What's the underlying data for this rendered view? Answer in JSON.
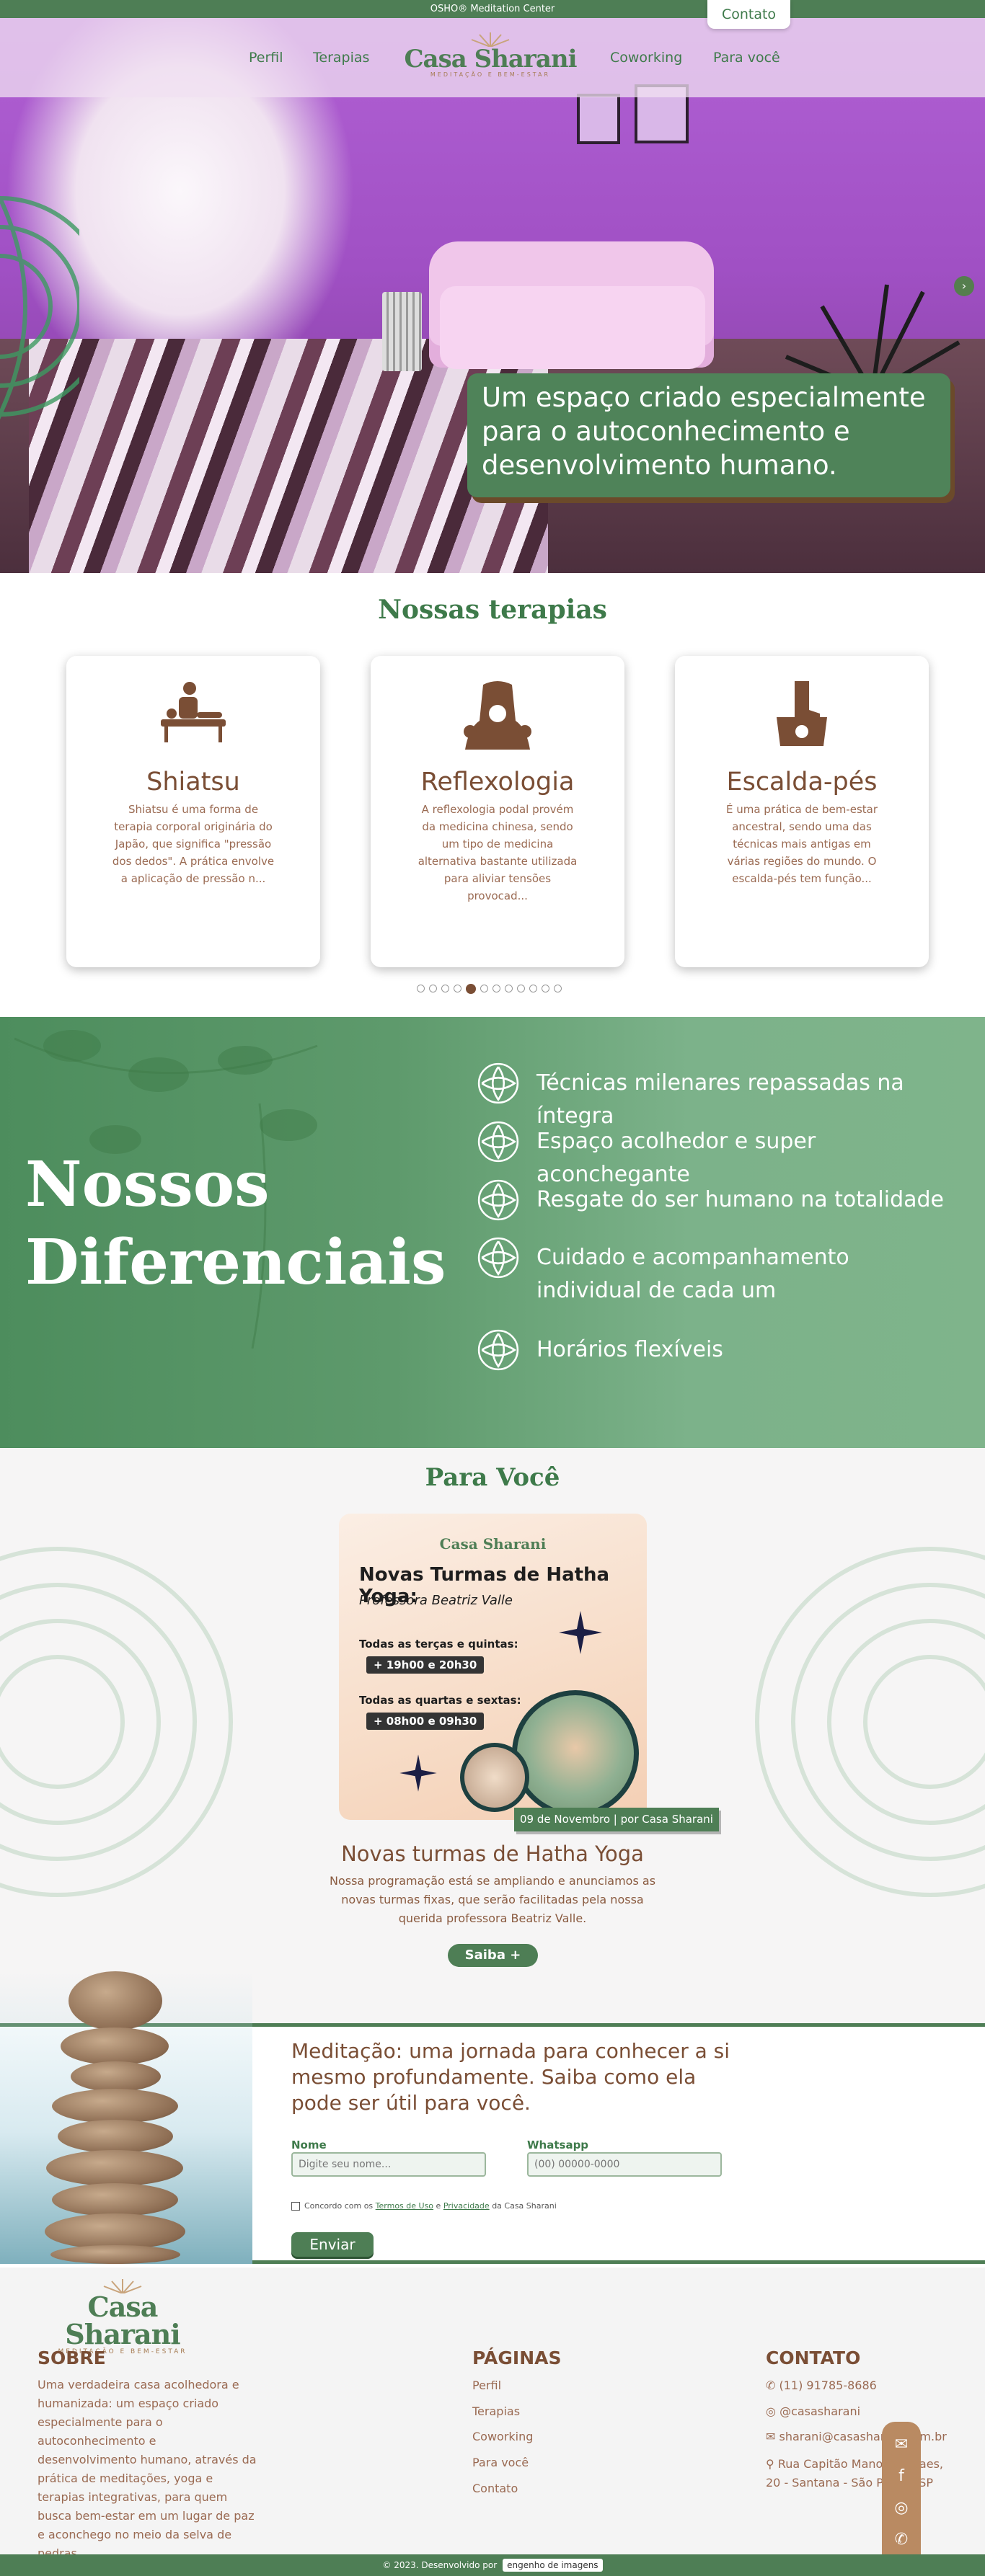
{
  "topbar": {
    "text": "OSHO® Meditation Center",
    "contact_label": "Contato"
  },
  "nav": {
    "items": [
      "Perfil",
      "Terapias",
      "Coworking",
      "Para você"
    ],
    "logo_name": "Casa Sharani",
    "logo_tagline": "MEDITAÇÃO E BEM-ESTAR"
  },
  "hero": {
    "caption": "Um espaço criado especialmente para o autoconhecimento e desenvolvimento humano."
  },
  "therapies": {
    "title": "Nossas terapias",
    "cards": [
      {
        "name": "Shiatsu",
        "text": "Shiatsu é uma forma de terapia corporal originária do Japão, que significa \"pressão dos dedos\". A prática envolve a aplicação de pressão n...",
        "icon": "massage-icon"
      },
      {
        "name": "Reflexologia",
        "text": "A reflexologia podal provém da medicina chinesa, sendo um tipo de medicina alternativa bastante utilizada para aliviar tensões provocad...",
        "icon": "foot-icon"
      },
      {
        "name": "Escalda-pés",
        "text": "É uma prática de bem-estar ancestral, sendo uma das técnicas mais antigas em várias regiões do mundo. O escalda-pés tem função...",
        "icon": "foot-bath-icon"
      }
    ],
    "dot_count": 12,
    "active_dot": 4
  },
  "differentials": {
    "title_line1": "Nossos",
    "title_line2": "Diferenciais",
    "items": [
      "Técnicas milenares repassadas na íntegra",
      "Espaço acolhedor e super aconchegante",
      "Resgate do ser humano na totalidade",
      "Cuidado e acompanhamento individual de cada um",
      "Horários flexíveis"
    ]
  },
  "para_voce": {
    "title": "Para Você",
    "post": {
      "logo": "Casa Sharani",
      "title": "Novas Turmas de Hatha Yoga:",
      "teacher": "Professora Beatriz Valle",
      "slot1_label": "Todas as terças e quintas:",
      "slot1_time": "19h00 e 20h30",
      "slot2_label": "Todas as quartas e sextas:",
      "slot2_time": "08h00 e 09h30"
    },
    "date": "09 de Novembro | por Casa Sharani",
    "heading": "Novas turmas de Hatha Yoga",
    "text": "Nossa programação está se ampliando e anunciamos as novas turmas fixas, que serão facilitadas pela nossa querida professora Beatriz Valle.",
    "button": "Saiba +"
  },
  "form": {
    "heading": "Meditação: uma jornada para conhecer a si mesmo profundamente. Saiba como ela pode ser útil para você.",
    "name_label": "Nome",
    "name_placeholder": "Digite seu nome...",
    "whatsapp_label": "Whatsapp",
    "whatsapp_placeholder": "(00) 00000-0000",
    "consent_prefix": "Concordo com os",
    "terms": "Termos de Uso",
    "and": "e",
    "privacy": "Privacidade",
    "consent_suffix": "da Casa Sharani",
    "submit": "Enviar"
  },
  "footer": {
    "about_title": "SOBRE",
    "about_text": "Uma verdadeira casa acolhedora e humanizada: um espaço criado especialmente para o autoconhecimento e desenvolvimento humano, através da prática de meditações, yoga e terapias integrativas, para quem busca bem-estar em um lugar de paz e aconchego no meio da selva de pedras.",
    "pages_title": "PÁGINAS",
    "pages": [
      "Perfil",
      "Terapias",
      "Coworking",
      "Para você",
      "Contato"
    ],
    "contact_title": "CONTATO",
    "phone": "(11) 91785-8686",
    "instagram": "@casasharani",
    "email": "sharani@casasharani.com.br",
    "address": "Rua Capitão Manoel Novaes, 20 - Santana - São Paulo - SP",
    "credit": "© 2023. Desenvolvido por",
    "credit_brand": "engenho de imagens"
  },
  "colors": {
    "primary_green": "#4e7e55",
    "brown": "#7a4e35",
    "accent_tan": "#b98a62"
  }
}
